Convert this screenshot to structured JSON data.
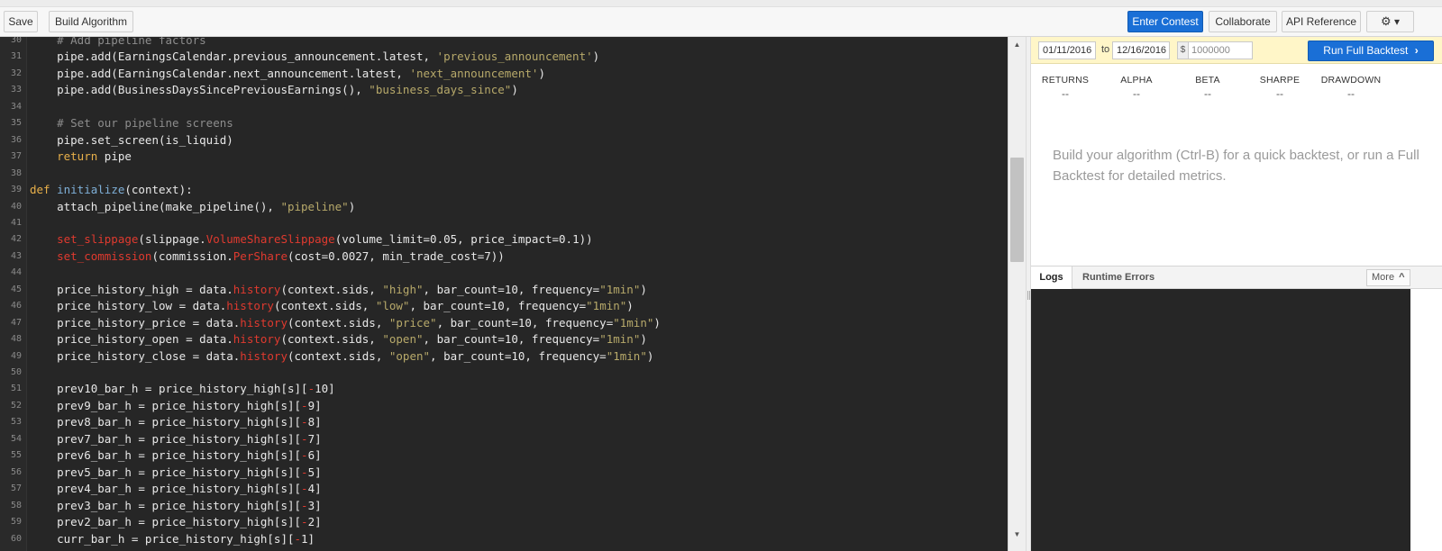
{
  "toolbar": {
    "save_label": "Save",
    "build_label": "Build Algorithm",
    "enter_contest_label": "Enter Contest",
    "collaborate_label": "Collaborate",
    "api_reference_label": "API Reference",
    "settings_caret": "▾"
  },
  "editor": {
    "lines": [
      {
        "n": "30",
        "parts": [
          [
            "cm",
            "    # Add pipeline factors"
          ]
        ]
      },
      {
        "n": "31",
        "parts": [
          [
            "",
            "    pipe.add(EarningsCalendar.previous_announcement.latest, "
          ],
          [
            "st",
            "'previous_announcement'"
          ],
          [
            "",
            ")"
          ]
        ]
      },
      {
        "n": "32",
        "parts": [
          [
            "",
            "    pipe.add(EarningsCalendar.next_announcement.latest, "
          ],
          [
            "st",
            "'next_announcement'"
          ],
          [
            "",
            ")"
          ]
        ]
      },
      {
        "n": "33",
        "parts": [
          [
            "",
            "    pipe.add(BusinessDaysSincePreviousEarnings(), "
          ],
          [
            "st",
            "\"business_days_since\""
          ],
          [
            "",
            ")"
          ]
        ]
      },
      {
        "n": "34",
        "parts": []
      },
      {
        "n": "35",
        "parts": [
          [
            "cm",
            "    # Set our pipeline screens"
          ]
        ]
      },
      {
        "n": "36",
        "parts": [
          [
            "",
            "    pipe.set_screen(is_liquid)"
          ]
        ]
      },
      {
        "n": "37",
        "parts": [
          [
            "kw",
            "    return"
          ],
          [
            "",
            " pipe"
          ]
        ]
      },
      {
        "n": "38",
        "parts": []
      },
      {
        "n": "39",
        "parts": [
          [
            "kw",
            "def"
          ],
          [
            "",
            " "
          ],
          [
            "fn",
            "initialize"
          ],
          [
            "",
            "(context):"
          ]
        ]
      },
      {
        "n": "40",
        "parts": [
          [
            "",
            "    attach_pipeline(make_pipeline(), "
          ],
          [
            "st",
            "\"pipeline\""
          ],
          [
            "",
            ")"
          ]
        ]
      },
      {
        "n": "41",
        "parts": []
      },
      {
        "n": "42",
        "parts": [
          [
            "rd",
            "    set_slippage"
          ],
          [
            "",
            "(slippage."
          ],
          [
            "rd",
            "VolumeShareSlippage"
          ],
          [
            "",
            "(volume_limit=0.05, price_impact=0.1))"
          ]
        ]
      },
      {
        "n": "43",
        "parts": [
          [
            "rd",
            "    set_commission"
          ],
          [
            "",
            "(commission."
          ],
          [
            "rd",
            "PerShare"
          ],
          [
            "",
            "(cost=0.0027, min_trade_cost=7))"
          ]
        ]
      },
      {
        "n": "44",
        "parts": []
      },
      {
        "n": "45",
        "parts": [
          [
            "",
            "    price_history_high = data."
          ],
          [
            "rd",
            "history"
          ],
          [
            "",
            "(context.sids, "
          ],
          [
            "st",
            "\"high\""
          ],
          [
            "",
            ", bar_count=10, frequency="
          ],
          [
            "st",
            "\"1min\""
          ],
          [
            "",
            ")"
          ]
        ]
      },
      {
        "n": "46",
        "parts": [
          [
            "",
            "    price_history_low = data."
          ],
          [
            "rd",
            "history"
          ],
          [
            "",
            "(context.sids, "
          ],
          [
            "st",
            "\"low\""
          ],
          [
            "",
            ", bar_count=10, frequency="
          ],
          [
            "st",
            "\"1min\""
          ],
          [
            "",
            ")"
          ]
        ]
      },
      {
        "n": "47",
        "parts": [
          [
            "",
            "    price_history_price = data."
          ],
          [
            "rd",
            "history"
          ],
          [
            "",
            "(context.sids, "
          ],
          [
            "st",
            "\"price\""
          ],
          [
            "",
            ", bar_count=10, frequency="
          ],
          [
            "st",
            "\"1min\""
          ],
          [
            "",
            ")"
          ]
        ]
      },
      {
        "n": "48",
        "parts": [
          [
            "",
            "    price_history_open = data."
          ],
          [
            "rd",
            "history"
          ],
          [
            "",
            "(context.sids, "
          ],
          [
            "st",
            "\"open\""
          ],
          [
            "",
            ", bar_count=10, frequency="
          ],
          [
            "st",
            "\"1min\""
          ],
          [
            "",
            ")"
          ]
        ]
      },
      {
        "n": "49",
        "parts": [
          [
            "",
            "    price_history_close = data."
          ],
          [
            "rd",
            "history"
          ],
          [
            "",
            "(context.sids, "
          ],
          [
            "st",
            "\"open\""
          ],
          [
            "",
            ", bar_count=10, frequency="
          ],
          [
            "st",
            "\"1min\""
          ],
          [
            "",
            ")"
          ]
        ]
      },
      {
        "n": "50",
        "parts": []
      },
      {
        "n": "51",
        "parts": [
          [
            "",
            "    prev10_bar_h = price_history_high[s]["
          ],
          [
            "rd",
            "-"
          ],
          [
            "",
            "10]"
          ]
        ]
      },
      {
        "n": "52",
        "parts": [
          [
            "",
            "    prev9_bar_h = price_history_high[s]["
          ],
          [
            "rd",
            "-"
          ],
          [
            "",
            "9]"
          ]
        ]
      },
      {
        "n": "53",
        "parts": [
          [
            "",
            "    prev8_bar_h = price_history_high[s]["
          ],
          [
            "rd",
            "-"
          ],
          [
            "",
            "8]"
          ]
        ]
      },
      {
        "n": "54",
        "parts": [
          [
            "",
            "    prev7_bar_h = price_history_high[s]["
          ],
          [
            "rd",
            "-"
          ],
          [
            "",
            "7]"
          ]
        ]
      },
      {
        "n": "55",
        "parts": [
          [
            "",
            "    prev6_bar_h = price_history_high[s]["
          ],
          [
            "rd",
            "-"
          ],
          [
            "",
            "6]"
          ]
        ]
      },
      {
        "n": "56",
        "parts": [
          [
            "",
            "    prev5_bar_h = price_history_high[s]["
          ],
          [
            "rd",
            "-"
          ],
          [
            "",
            "5]"
          ]
        ]
      },
      {
        "n": "57",
        "parts": [
          [
            "",
            "    prev4_bar_h = price_history_high[s]["
          ],
          [
            "rd",
            "-"
          ],
          [
            "",
            "4]"
          ]
        ]
      },
      {
        "n": "58",
        "parts": [
          [
            "",
            "    prev3_bar_h = price_history_high[s]["
          ],
          [
            "rd",
            "-"
          ],
          [
            "",
            "3]"
          ]
        ]
      },
      {
        "n": "59",
        "parts": [
          [
            "",
            "    prev2_bar_h = price_history_high[s]["
          ],
          [
            "rd",
            "-"
          ],
          [
            "",
            "2]"
          ]
        ]
      },
      {
        "n": "60",
        "parts": [
          [
            "",
            "    curr_bar_h = price_history_high[s]["
          ],
          [
            "rd",
            "-"
          ],
          [
            "",
            "1]"
          ]
        ]
      }
    ]
  },
  "backtest": {
    "start_date": "01/11/2016",
    "to_label": "to",
    "end_date": "12/16/2016",
    "currency_symbol": "$",
    "capital": "1000000",
    "run_label": "Run Full Backtest",
    "run_chevron": "›",
    "metrics": [
      {
        "label": "RETURNS",
        "value": "--"
      },
      {
        "label": "ALPHA",
        "value": "--"
      },
      {
        "label": "BETA",
        "value": "--"
      },
      {
        "label": "SHARPE",
        "value": "--"
      },
      {
        "label": "DRAWDOWN",
        "value": "--"
      }
    ],
    "hint": "Build your algorithm (Ctrl-B) for a quick backtest, or run a Full Backtest for detailed metrics."
  },
  "logs": {
    "tab_logs": "Logs",
    "tab_runtime_errors": "Runtime Errors",
    "more_label": "More",
    "more_caret": "^"
  },
  "colors": {
    "accent": "#1a6fd6",
    "editor_bg": "#262626",
    "backtest_bar_bg": "#fff6c8"
  }
}
